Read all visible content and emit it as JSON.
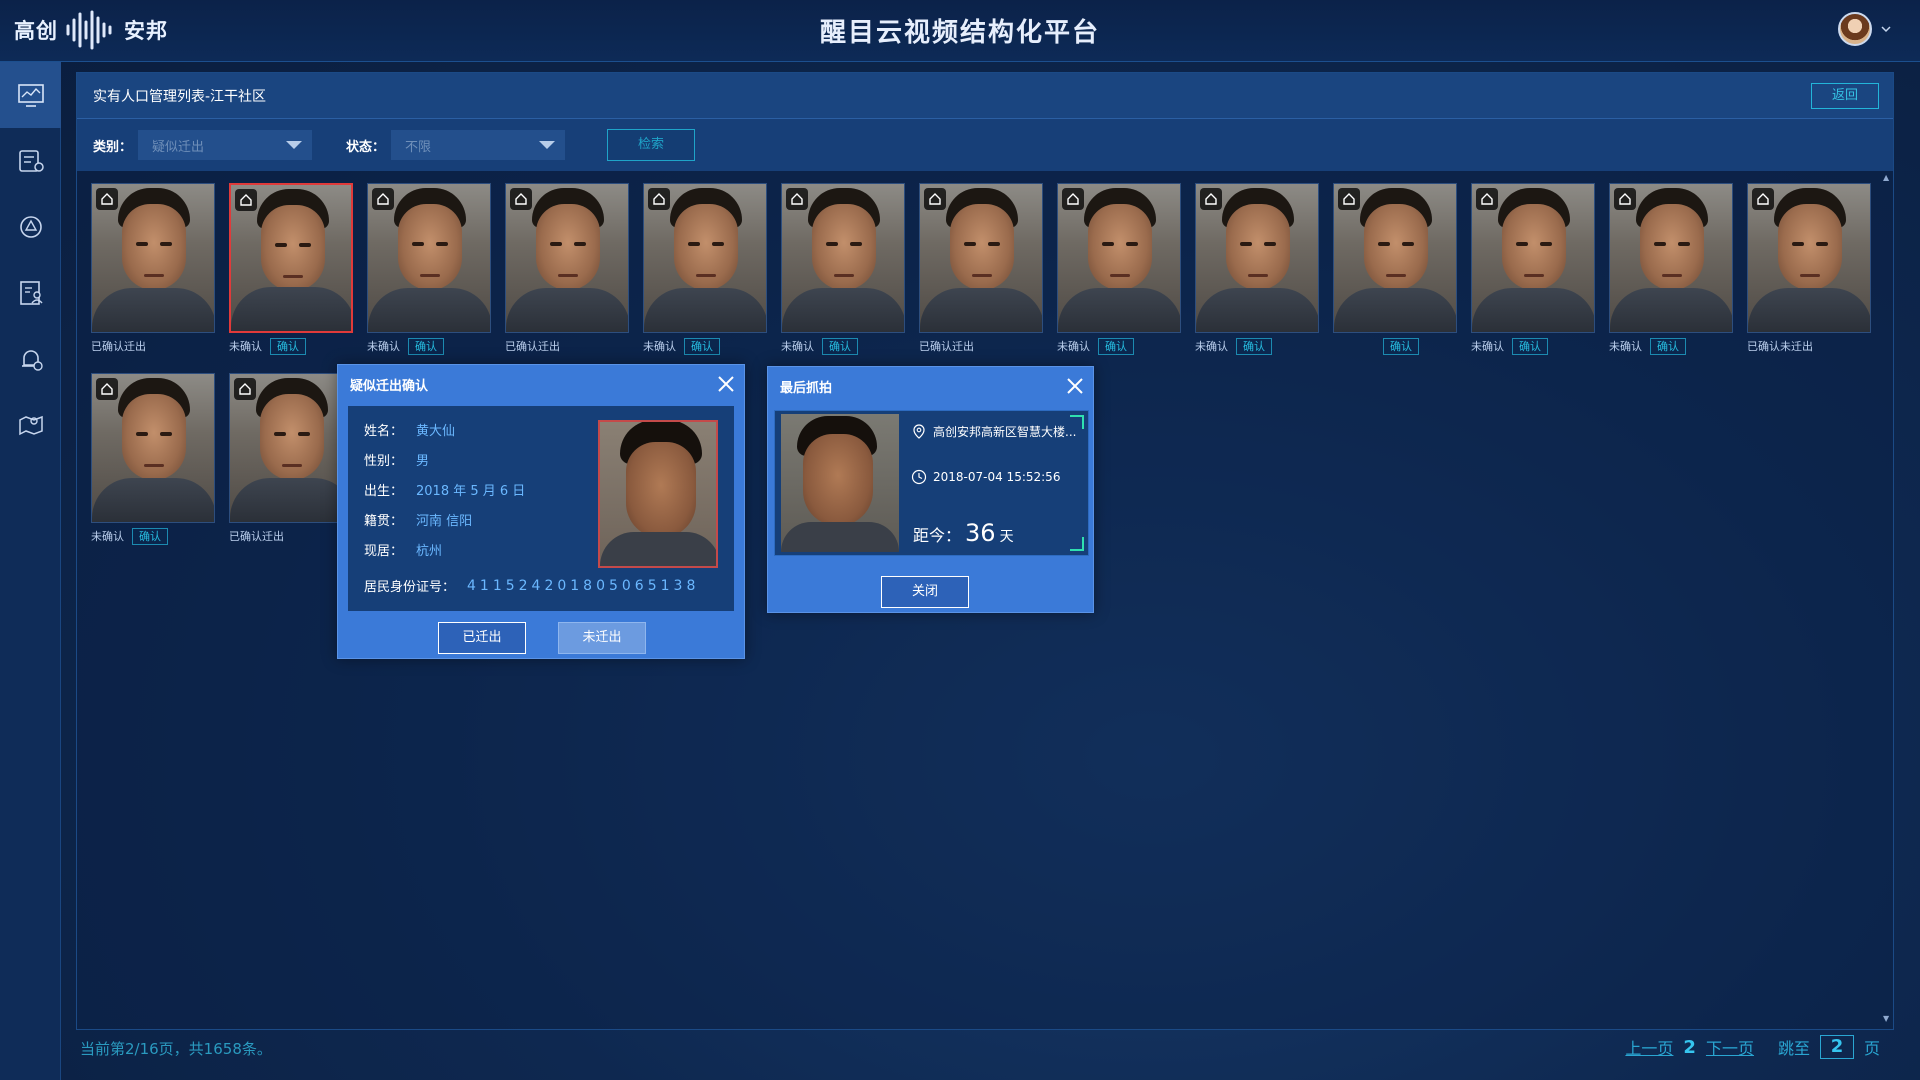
{
  "app": {
    "logo_text_left": "高创",
    "logo_text_right": "安邦",
    "title": "醒目云视频结构化平台"
  },
  "sidebar": {
    "items": [
      {
        "icon": "monitor-icon",
        "active": true
      },
      {
        "icon": "list-settings-icon",
        "active": false
      },
      {
        "icon": "target-icon",
        "active": false
      },
      {
        "icon": "document-person-icon",
        "active": false
      },
      {
        "icon": "alarm-bell-icon",
        "active": false
      },
      {
        "icon": "map-pin-icon",
        "active": false
      }
    ]
  },
  "panel": {
    "title": "实有人口管理列表-江干社区",
    "return_label": "返回"
  },
  "filters": {
    "category_label": "类别：",
    "category_value": "疑似迁出",
    "status_label": "状态：",
    "status_value": "不限",
    "search_label": "检索"
  },
  "cards": [
    {
      "status": "已确认迁出",
      "confirm": ""
    },
    {
      "status": "未确认",
      "confirm": "确认",
      "selected": true
    },
    {
      "status": "未确认",
      "confirm": "确认"
    },
    {
      "status": "已确认迁出",
      "confirm": ""
    },
    {
      "status": "未确认",
      "confirm": "确认"
    },
    {
      "status": "未确认",
      "confirm": "确认"
    },
    {
      "status": "已确认迁出",
      "confirm": ""
    },
    {
      "status": "未确认",
      "confirm": "确认"
    },
    {
      "status": "未确认",
      "confirm": "确认"
    },
    {
      "status": "",
      "confirm": "确认"
    },
    {
      "status": "未确认",
      "confirm": "确认"
    },
    {
      "status": "未确认",
      "confirm": "确认"
    },
    {
      "status": "已确认未迁出",
      "confirm": ""
    },
    {
      "status": "未确认",
      "confirm": "确认"
    },
    {
      "status": "已确认迁出",
      "confirm": ""
    }
  ],
  "footer": {
    "status": "当前第2/16页，共1658条。",
    "prev": "上一页",
    "current_page": "2",
    "next": "下一页",
    "jump_label": "跳至",
    "jump_value": "2",
    "page_unit": "页"
  },
  "confirm_modal": {
    "title": "疑似迁出确认",
    "name_label": "姓名：",
    "name": "黄大仙",
    "gender_label": "性别：",
    "gender": "男",
    "birth_label": "出生：",
    "birth": "2018 年 5 月 6 日",
    "origin_label": "籍贯：",
    "origin": "河南 信阳",
    "residence_label": "现居：",
    "residence": "杭州",
    "id_label": "居民身份证号：",
    "id_number": "411524201805065138",
    "btn_moved": "已迁出",
    "btn_not_moved": "未迁出"
  },
  "snapshot_modal": {
    "title": "最后抓拍",
    "location": "高创安邦高新区智慧大楼...",
    "time": "2018-07-04  15:52:56",
    "since_label": "距今：",
    "since_value": "36",
    "since_unit": "天",
    "close_label": "关闭"
  },
  "colors": {
    "header_bg": "#0d2a57",
    "accent": "#27bde0",
    "modal_bg": "#3b7ad8",
    "selected_border": "#e03a3a"
  }
}
